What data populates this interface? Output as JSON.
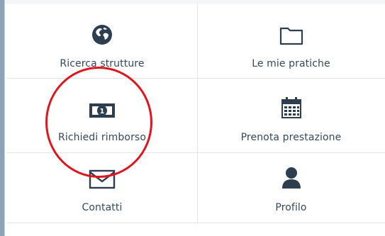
{
  "menu": {
    "items": [
      {
        "label": "Ricerca strutture",
        "icon": "globe-icon"
      },
      {
        "label": "Le mie pratiche",
        "icon": "folder-icon"
      },
      {
        "label": "Richiedi rimborso",
        "icon": "money-icon"
      },
      {
        "label": "Prenota prestazione",
        "icon": "calendar-icon"
      },
      {
        "label": "Contatti",
        "icon": "envelope-icon"
      },
      {
        "label": "Profilo",
        "icon": "user-icon"
      }
    ]
  },
  "colors": {
    "text": "#34495e",
    "icon": "#2c3e50",
    "divider": "#e1e6ea",
    "annotation": "#e0161e"
  }
}
